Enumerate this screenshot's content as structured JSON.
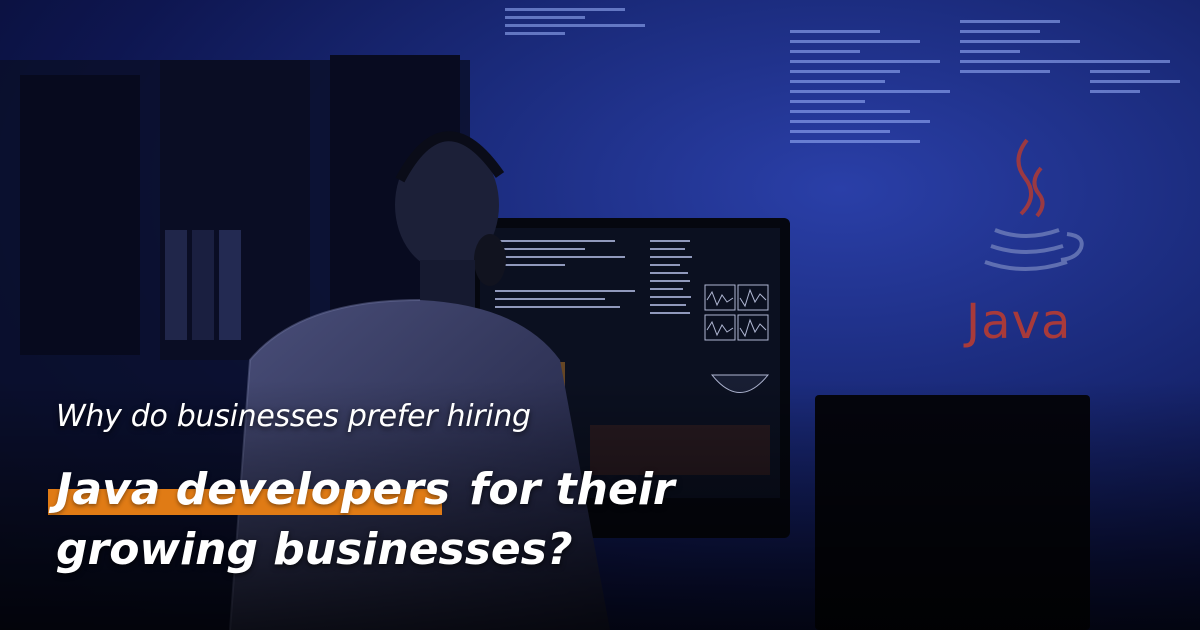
{
  "headline": {
    "subtitle": "Why do businesses prefer hiring",
    "highlight": "Java developers",
    "line2_rest": "for their",
    "line3": "growing businesses?"
  },
  "logo": {
    "word": "Java",
    "icon": "java-coffee-cup-icon"
  },
  "colors": {
    "accent_orange": "#e07b15",
    "java_red": "#a83a3a",
    "background_blue": "#1a2a7a"
  }
}
